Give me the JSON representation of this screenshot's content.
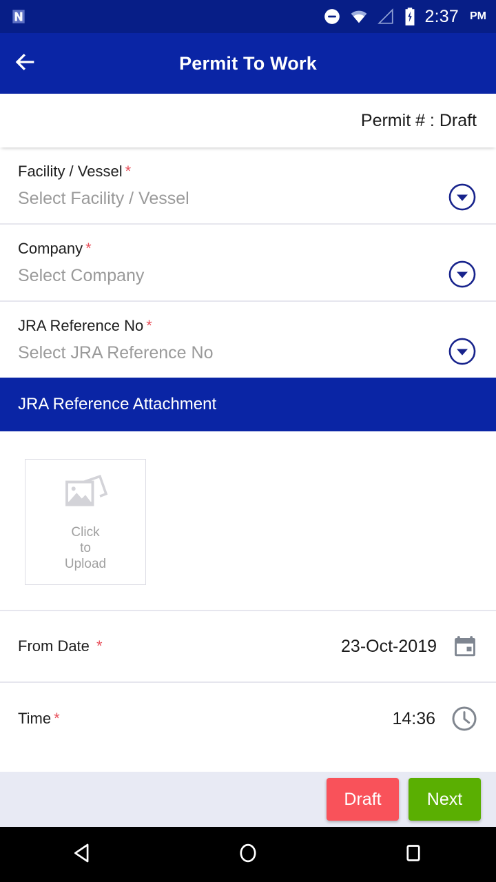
{
  "statusbar": {
    "time": "2:37",
    "ampm": "PM",
    "icons": [
      "app-notification-icon",
      "do-not-disturb-icon",
      "wifi-icon",
      "cellular-signal-icon",
      "battery-charging-icon"
    ]
  },
  "appbar": {
    "title": "Permit To Work",
    "back_icon": "back-arrow-icon"
  },
  "permit": {
    "label": "Permit # : Draft"
  },
  "form": {
    "fields": [
      {
        "label": "Facility / Vessel",
        "required": "*",
        "placeholder": "Select Facility / Vessel",
        "icon": "chevron-down-circle-icon"
      },
      {
        "label": "Company",
        "required": "*",
        "placeholder": "Select Company",
        "icon": "chevron-down-circle-icon"
      },
      {
        "label": "JRA Reference No",
        "required": "*",
        "placeholder": "Select JRA Reference No",
        "icon": "chevron-down-circle-icon"
      }
    ]
  },
  "attachment": {
    "section_title": "JRA Reference Attachment",
    "upload_line1": "Click",
    "upload_line2": "to",
    "upload_line3": "Upload",
    "upload_icon": "photo-stack-icon"
  },
  "datetime": {
    "from_date": {
      "label": "From Date",
      "required": "*",
      "value": "23-Oct-2019",
      "icon": "calendar-icon"
    },
    "time": {
      "label": "Time",
      "required": "*",
      "value": "14:36",
      "icon": "clock-icon"
    }
  },
  "actions": {
    "draft_label": "Draft",
    "next_label": "Next"
  },
  "navbar": {
    "back": "nav-back-icon",
    "home": "nav-home-icon",
    "recents": "nav-recents-icon"
  },
  "colors": {
    "statusbar": "#071E87",
    "appbar": "#0A25A5",
    "section_header": "#0A25A5",
    "required_star": "#E8505B",
    "draft_button": "#F9525A",
    "next_button": "#5AAF02",
    "action_bar": "#E8EAF4",
    "navbar": "#000000"
  }
}
